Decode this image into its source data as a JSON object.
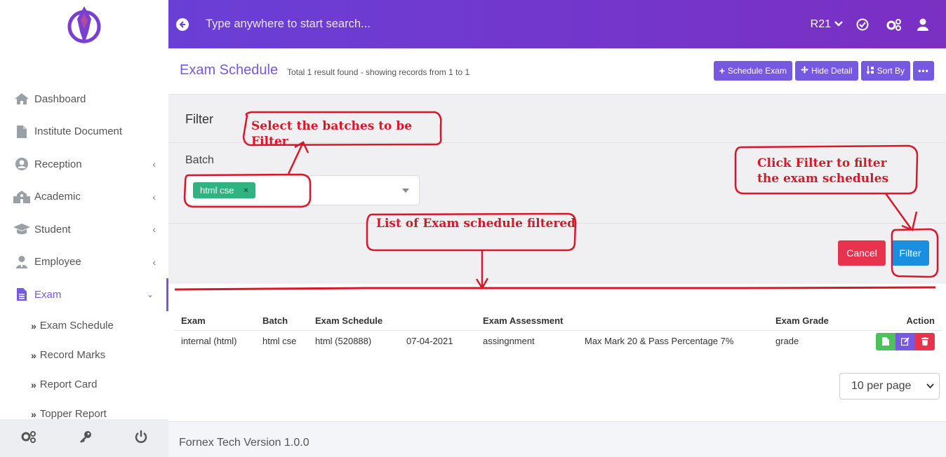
{
  "topbar": {
    "search_placeholder": "Type anywhere to start search...",
    "year": "R21"
  },
  "sidebar": {
    "items": [
      {
        "label": "Dashboard"
      },
      {
        "label": "Institute Document"
      },
      {
        "label": "Reception"
      },
      {
        "label": "Academic"
      },
      {
        "label": "Student"
      },
      {
        "label": "Employee"
      },
      {
        "label": "Exam"
      }
    ],
    "sub_items": [
      {
        "label": "Exam Schedule"
      },
      {
        "label": "Record Marks"
      },
      {
        "label": "Report Card"
      },
      {
        "label": "Topper Report"
      }
    ]
  },
  "page": {
    "title": "Exam Schedule",
    "subtitle": "Total 1 result found - showing records from 1 to 1",
    "buttons": {
      "schedule": "Schedule Exam",
      "hide": "Hide Detail",
      "sort": "Sort By"
    }
  },
  "filter": {
    "title": "Filter",
    "batch_label": "Batch",
    "batch_tag": "html cse",
    "tag_remove": "×",
    "cancel": "Cancel",
    "submit": "Filter"
  },
  "table": {
    "headers": [
      "Exam",
      "Batch",
      "Exam Schedule",
      "",
      "Exam Assessment",
      "",
      "Exam Grade",
      "Action"
    ],
    "rows": [
      [
        "internal (html)",
        "html cse",
        "html (520888)",
        "07-04-2021",
        "assingnment",
        "Max Mark 20 & Pass Percentage 7%",
        "grade"
      ]
    ]
  },
  "pagination": {
    "per_page": "10 per page"
  },
  "footer": {
    "text": "Fornex Tech Version 1.0.0"
  },
  "annotations": {
    "select_batches": "Select the batches to be Filter",
    "click_filter": "Click Filter to filter the exam schedules",
    "list_filtered": "List of Exam schedule filtered"
  },
  "colors": {
    "accent": "#7559e0",
    "annotation": "#d8172a",
    "tag": "#2fb380",
    "cancel": "#e8334f",
    "filter": "#1a8fe0"
  }
}
